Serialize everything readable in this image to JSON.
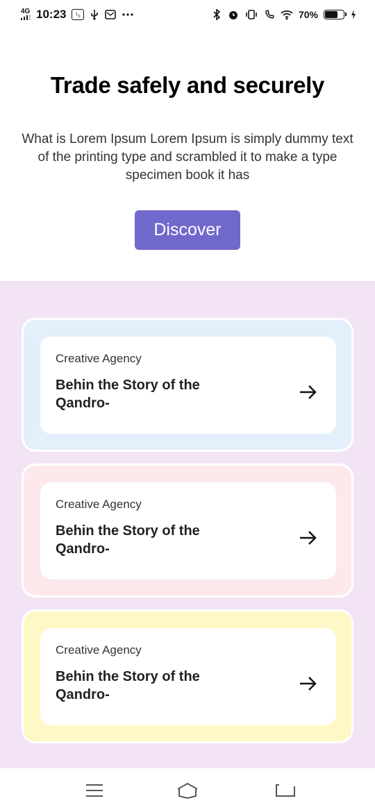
{
  "status_bar": {
    "network": "4G",
    "time": "10:23",
    "notif_box": "¹₀",
    "battery_pct": "70%",
    "battery_level": 0.7
  },
  "hero": {
    "title": "Trade safely and securely",
    "description": "What is Lorem Ipsum Lorem Ipsum is simply dummy text of the printing  type and scrambled it to make a type specimen book it has",
    "button_label": "Discover"
  },
  "cards": [
    {
      "category": "Creative Agency",
      "title": "Behin the Story of the Qandro-",
      "color": "#e3f0fb"
    },
    {
      "category": "Creative Agency",
      "title": "Behin the Story of the Qandro-",
      "color": "#fde8ec"
    },
    {
      "category": "Creative Agency",
      "title": "Behin the Story of the Qandro-",
      "color": "#fef8c6"
    }
  ],
  "colors": {
    "accent": "#7168cc",
    "section_bg": "#f2e4f5"
  },
  "icons": {
    "card_arrow": "arrow-right-icon",
    "nav": [
      "menu-icon",
      "home-icon",
      "back-icon"
    ]
  }
}
